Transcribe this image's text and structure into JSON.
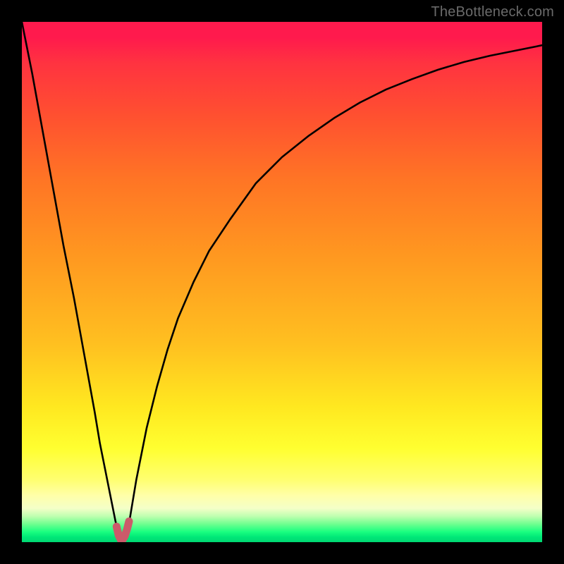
{
  "watermark": "TheBottleneck.com",
  "colors": {
    "frame": "#000000",
    "curve": "#000000",
    "marker": "#cc5a6a",
    "gradient_top": "#ff1a4d",
    "gradient_mid": "#ffe820",
    "gradient_bottom": "#00d872"
  },
  "chart_data": {
    "type": "line",
    "title": "",
    "xlabel": "",
    "ylabel": "",
    "xlim": [
      0,
      100
    ],
    "ylim": [
      0,
      100
    ],
    "notes": "Background vertical gradient red→yellow→green. Single black curve with a sharp V-shaped minimum near x≈19 touching y≈0, left branch rises steeply to top-left, right branch rises with decreasing slope toward top-right. Short pink/red marker segment at the minimum.",
    "x": [
      0,
      2,
      4,
      6,
      8,
      10,
      12,
      14,
      15,
      16,
      17,
      18,
      18.5,
      19,
      19.5,
      20,
      20.5,
      21,
      22,
      24,
      26,
      28,
      30,
      33,
      36,
      40,
      45,
      50,
      55,
      60,
      65,
      70,
      75,
      80,
      85,
      90,
      95,
      100
    ],
    "y": [
      100,
      90,
      79,
      68,
      57,
      47,
      36,
      25,
      19,
      14,
      9,
      4,
      2,
      0.5,
      0.5,
      1,
      3,
      6,
      12,
      22,
      30,
      37,
      43,
      50,
      56,
      62,
      69,
      74,
      78,
      81.5,
      84.5,
      87,
      89,
      90.8,
      92.3,
      93.5,
      94.5,
      95.5
    ],
    "marker": {
      "x": [
        18.2,
        18.6,
        19.0,
        19.4,
        19.8,
        20.2,
        20.6
      ],
      "y": [
        3.0,
        1.3,
        0.5,
        0.5,
        1.2,
        2.4,
        4.0
      ]
    }
  }
}
